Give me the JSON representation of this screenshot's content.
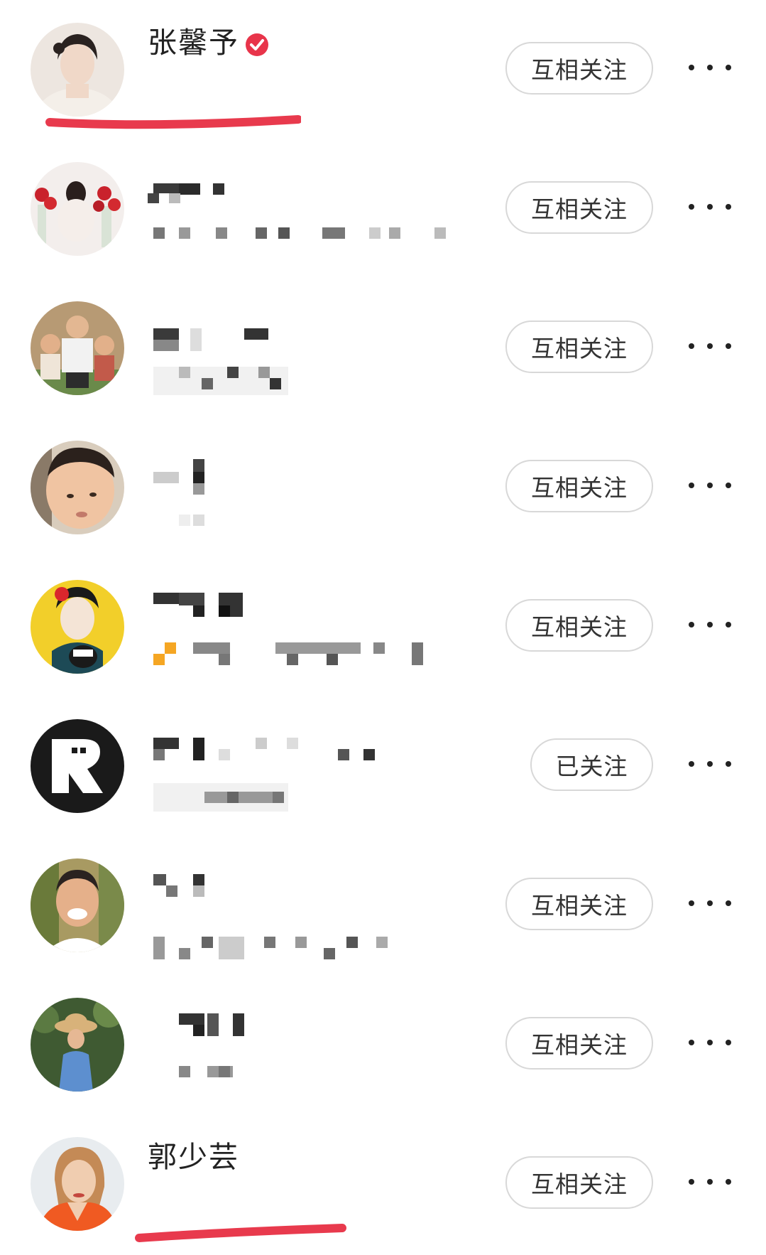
{
  "users": [
    {
      "name": "张馨予",
      "verified": true,
      "follow_label": "互相关注"
    },
    {
      "name": "",
      "verified": false,
      "follow_label": "互相关注"
    },
    {
      "name": "",
      "verified": false,
      "follow_label": "互相关注"
    },
    {
      "name": "",
      "verified": false,
      "follow_label": "互相关注"
    },
    {
      "name": "",
      "verified": false,
      "follow_label": "互相关注"
    },
    {
      "name": "",
      "verified": false,
      "follow_label": "已关注"
    },
    {
      "name": "",
      "verified": false,
      "follow_label": "互相关注"
    },
    {
      "name": "",
      "verified": false,
      "follow_label": "互相关注"
    },
    {
      "name": "郭少芸",
      "verified": false,
      "follow_label": "互相关注"
    }
  ],
  "colors": {
    "underline": "#e83a4d",
    "verified_badge": "#e8344a",
    "button_border": "#d8d8d8",
    "text": "#222222"
  },
  "icons": [
    "verified-badge-icon",
    "more-dots-icon"
  ]
}
